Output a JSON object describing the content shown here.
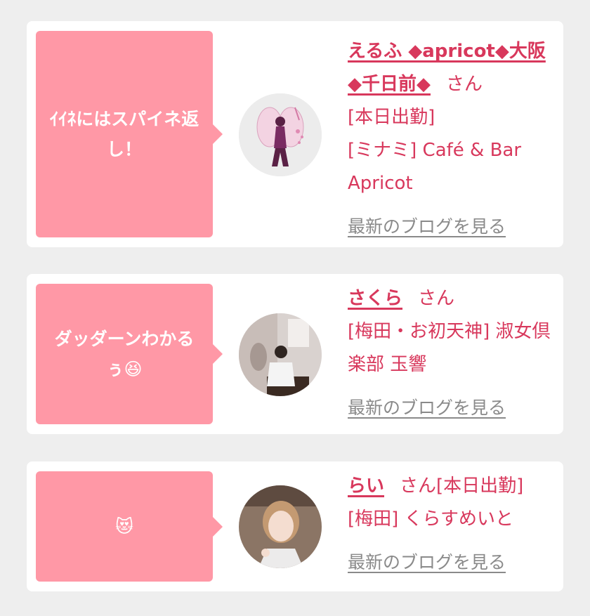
{
  "posts": [
    {
      "message": "ｲｲﾈにはスパイネ返し！",
      "name": "えるふ ◆apricot◆大阪◆千日前◆",
      "honorific": "さん",
      "status_line": "[本日出勤]",
      "shop": "[ミナミ] Café & Bar Apricot",
      "blog_link": "最新のブログを見る",
      "avatar_icon": "fairy-avatar"
    },
    {
      "message": "ダッダーンわかるぅ😆",
      "name": "さくら",
      "honorific": "さん",
      "shop": "[梅田・お初天神] 淑女倶楽部 玉響",
      "blog_link": "最新のブログを見る",
      "avatar_icon": "photo-avatar"
    },
    {
      "message": "😻",
      "name": "らい",
      "honorific": "さん[本日出勤]",
      "shop": "[梅田] くらすめいと",
      "blog_link": "最新のブログを見る",
      "avatar_icon": "photo-avatar"
    }
  ]
}
